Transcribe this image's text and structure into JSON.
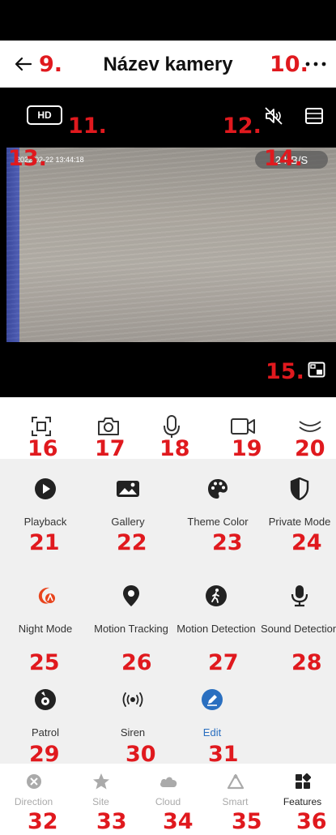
{
  "header": {
    "title": "Název kamery",
    "back_icon": "arrow-left-icon",
    "more_icon": "ellipsis-icon"
  },
  "video": {
    "quality_label": "HD",
    "timestamp": "2022-02-22 13:44:18",
    "data_rate": "2 KB/S",
    "mute_icon": "speaker-muted-icon",
    "layout_icon": "layout-icon",
    "pip_icon": "picture-in-picture-icon"
  },
  "toolbar": {
    "items": [
      {
        "icon": "fullscreen-icon"
      },
      {
        "icon": "camera-snapshot-icon"
      },
      {
        "icon": "microphone-icon"
      },
      {
        "icon": "video-record-icon"
      },
      {
        "icon": "collapse-chevron-icon"
      }
    ]
  },
  "features": {
    "items": [
      {
        "label": "Playback",
        "icon": "play-circle-icon"
      },
      {
        "label": "Gallery",
        "icon": "image-icon"
      },
      {
        "label": "Theme Color",
        "icon": "palette-icon"
      },
      {
        "label": "Private Mode",
        "icon": "shield-half-icon"
      },
      {
        "label": "Night Mode",
        "icon": "night-mode-icon"
      },
      {
        "label": "Motion Tracking",
        "icon": "location-pin-icon"
      },
      {
        "label": "Motion Detection",
        "icon": "walking-person-icon"
      },
      {
        "label": "Sound Detection",
        "icon": "microphone-stand-icon"
      },
      {
        "label": "Patrol",
        "icon": "patrol-icon"
      },
      {
        "label": "Siren",
        "icon": "siren-waves-icon"
      },
      {
        "label": "Edit",
        "icon": "edit-pencil-icon"
      }
    ]
  },
  "bottom_nav": {
    "items": [
      {
        "label": "Direction",
        "icon": "direction-pad-icon"
      },
      {
        "label": "Site",
        "icon": "star-icon"
      },
      {
        "label": "Cloud",
        "icon": "cloud-icon"
      },
      {
        "label": "Smart",
        "icon": "smart-triangle-icon"
      },
      {
        "label": "Features",
        "icon": "grid-features-icon"
      }
    ],
    "active": "Features"
  },
  "annotations": [
    "9.",
    "10.",
    "11.",
    "12.",
    "13.",
    "14.",
    "15.",
    "16",
    "17",
    "18",
    "19",
    "20",
    "21",
    "22",
    "23",
    "24",
    "25",
    "26",
    "27",
    "28",
    "29",
    "30",
    "31",
    "32",
    "33",
    "34",
    "35",
    "36"
  ],
  "colors": {
    "annotation": "#e0191e",
    "night_mode_accent": "#e8441d",
    "edit_accent": "#2a6fc0",
    "active_nav": "#222222",
    "inactive_nav": "#aaaaaa"
  }
}
